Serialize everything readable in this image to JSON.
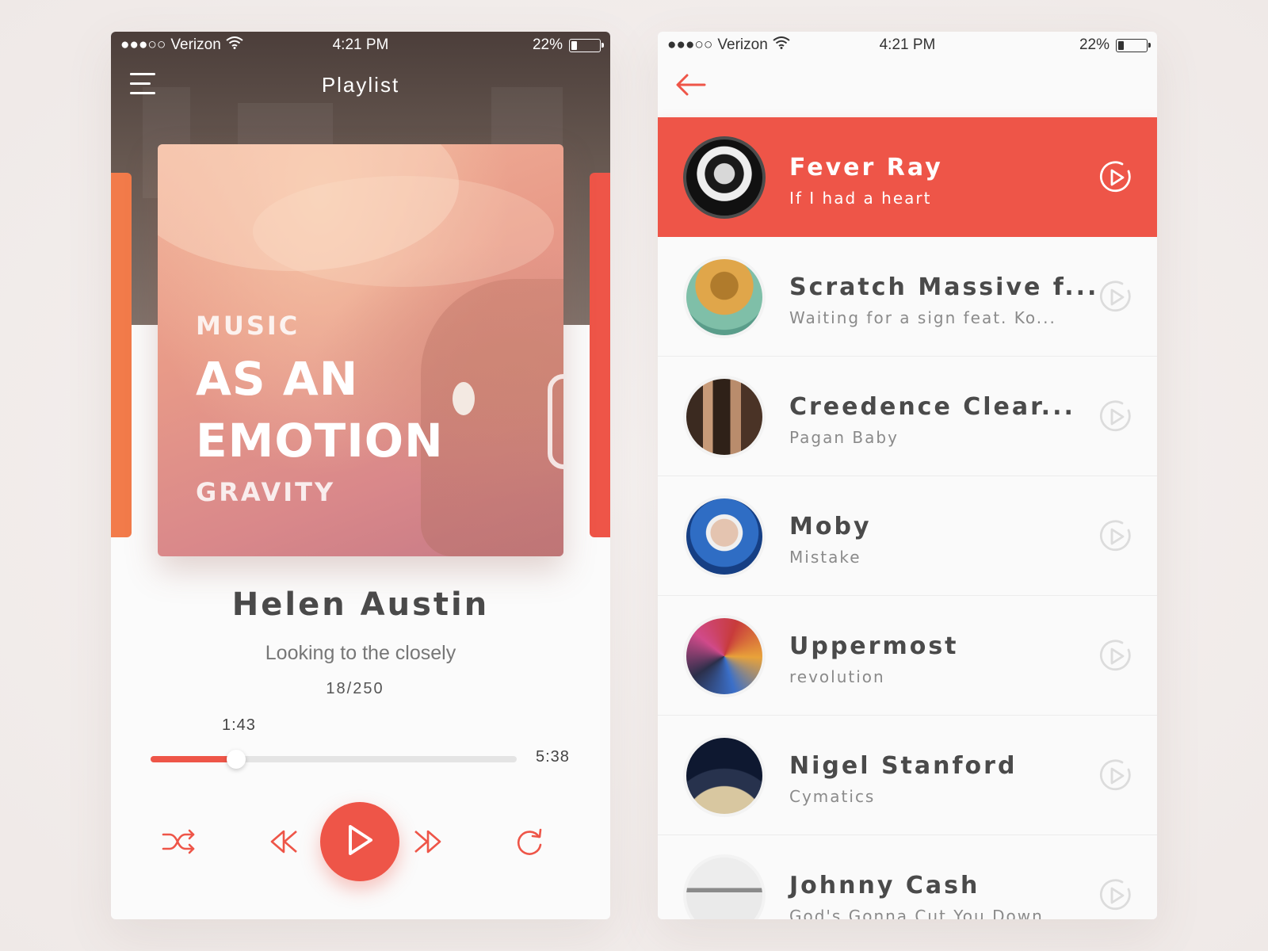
{
  "status_bar": {
    "signal": "●●●○○",
    "carrier": "Verizon",
    "time": "4:21 PM",
    "battery": "22%"
  },
  "player": {
    "title": "Playlist",
    "album_lines": [
      "MUSIC",
      "AS AN",
      "EMOTION",
      "GRAVITY"
    ],
    "artist": "Helen Austin",
    "song": "Looking to the closely",
    "track_position": "18/250",
    "elapsed": "1:43",
    "duration": "5:38",
    "progress": 0.234,
    "accent_color": "#ee5548",
    "side_accent_color": "#f27b4a"
  },
  "playlist": {
    "tracks": [
      {
        "artist": "Fever Ray",
        "song": "If I had a heart",
        "active": true
      },
      {
        "artist": "Scratch Massive f...",
        "song": "Waiting for a sign feat. Ko..."
      },
      {
        "artist": "Creedence Clear...",
        "song": "Pagan Baby"
      },
      {
        "artist": "Moby",
        "song": "Mistake"
      },
      {
        "artist": "Uppermost",
        "song": "revolution"
      },
      {
        "artist": "Nigel Stanford",
        "song": "Cymatics"
      },
      {
        "artist": "Johnny Cash",
        "song": "God's Gonna Cut You Down"
      }
    ]
  },
  "icons": {
    "menu": "menu-icon",
    "wifi": "wifi-icon",
    "battery": "battery-icon",
    "back": "arrow-left-icon",
    "shuffle": "shuffle-icon",
    "previous": "rewind-icon",
    "play": "play-icon",
    "next": "fast-forward-icon",
    "repeat": "repeat-icon"
  }
}
